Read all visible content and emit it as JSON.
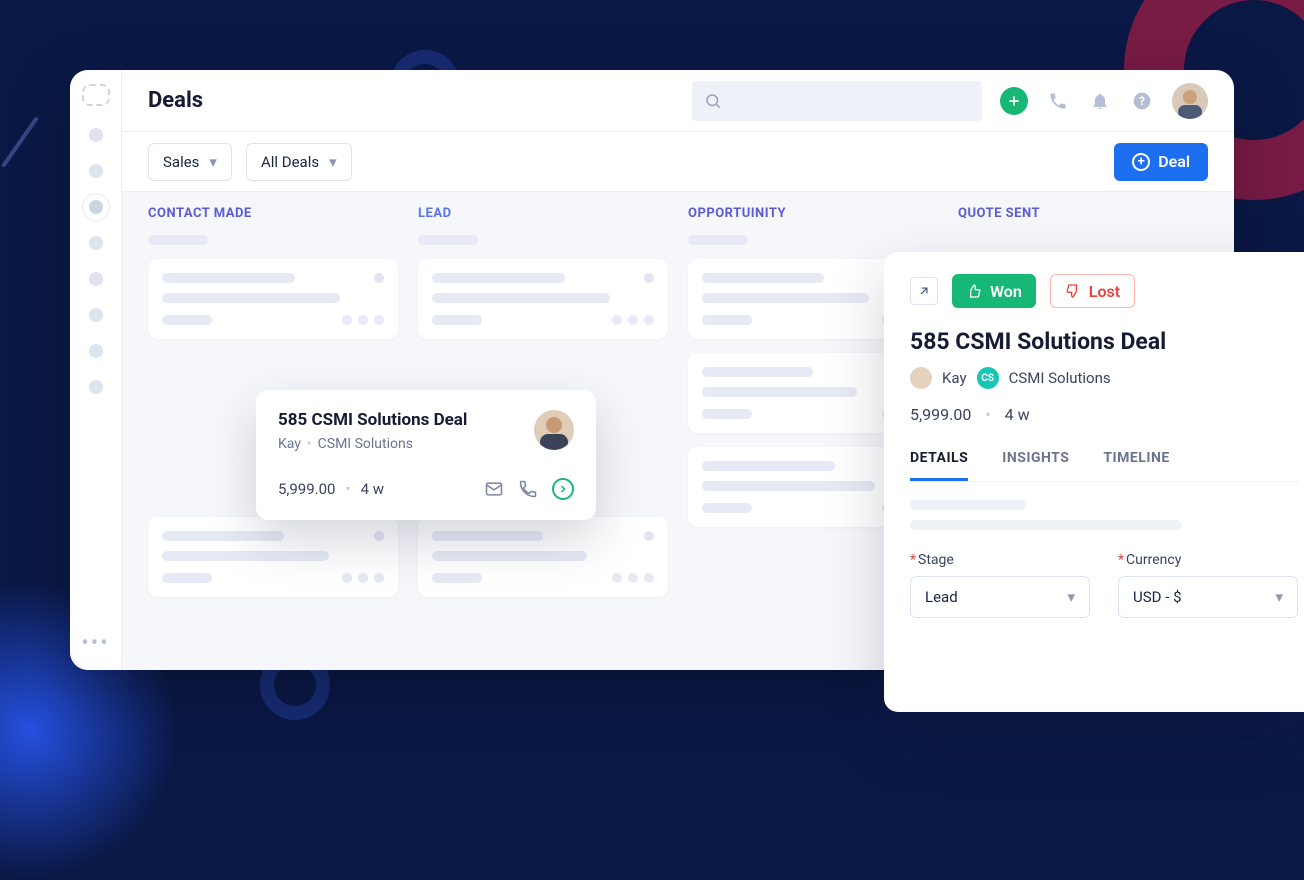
{
  "header": {
    "title": "Deals"
  },
  "filters": {
    "pipeline": "Sales",
    "scope": "All Deals",
    "new_button": "Deal"
  },
  "columns": [
    {
      "label": "CONTACT MADE"
    },
    {
      "label": "LEAD"
    },
    {
      "label": "OPPORTUINITY"
    },
    {
      "label": "QUOTE SENT"
    }
  ],
  "deal_card": {
    "title": "585 CSMI Solutions Deal",
    "contact": "Kay",
    "company": "CSMI Solutions",
    "amount": "5,999.00",
    "age": "4 w"
  },
  "panel": {
    "won": "Won",
    "lost": "Lost",
    "title": "585 CSMI Solutions Deal",
    "contact": "Kay",
    "company_badge": "CS",
    "company": "CSMI Solutions",
    "amount": "5,999.00",
    "age": "4 w",
    "tabs": {
      "details": "DETAILS",
      "insights": "INSIGHTS",
      "timeline": "TIMELINE"
    },
    "fields": {
      "stage_label": "Stage",
      "stage_value": "Lead",
      "currency_label": "Currency",
      "currency_value": "USD - $"
    }
  }
}
